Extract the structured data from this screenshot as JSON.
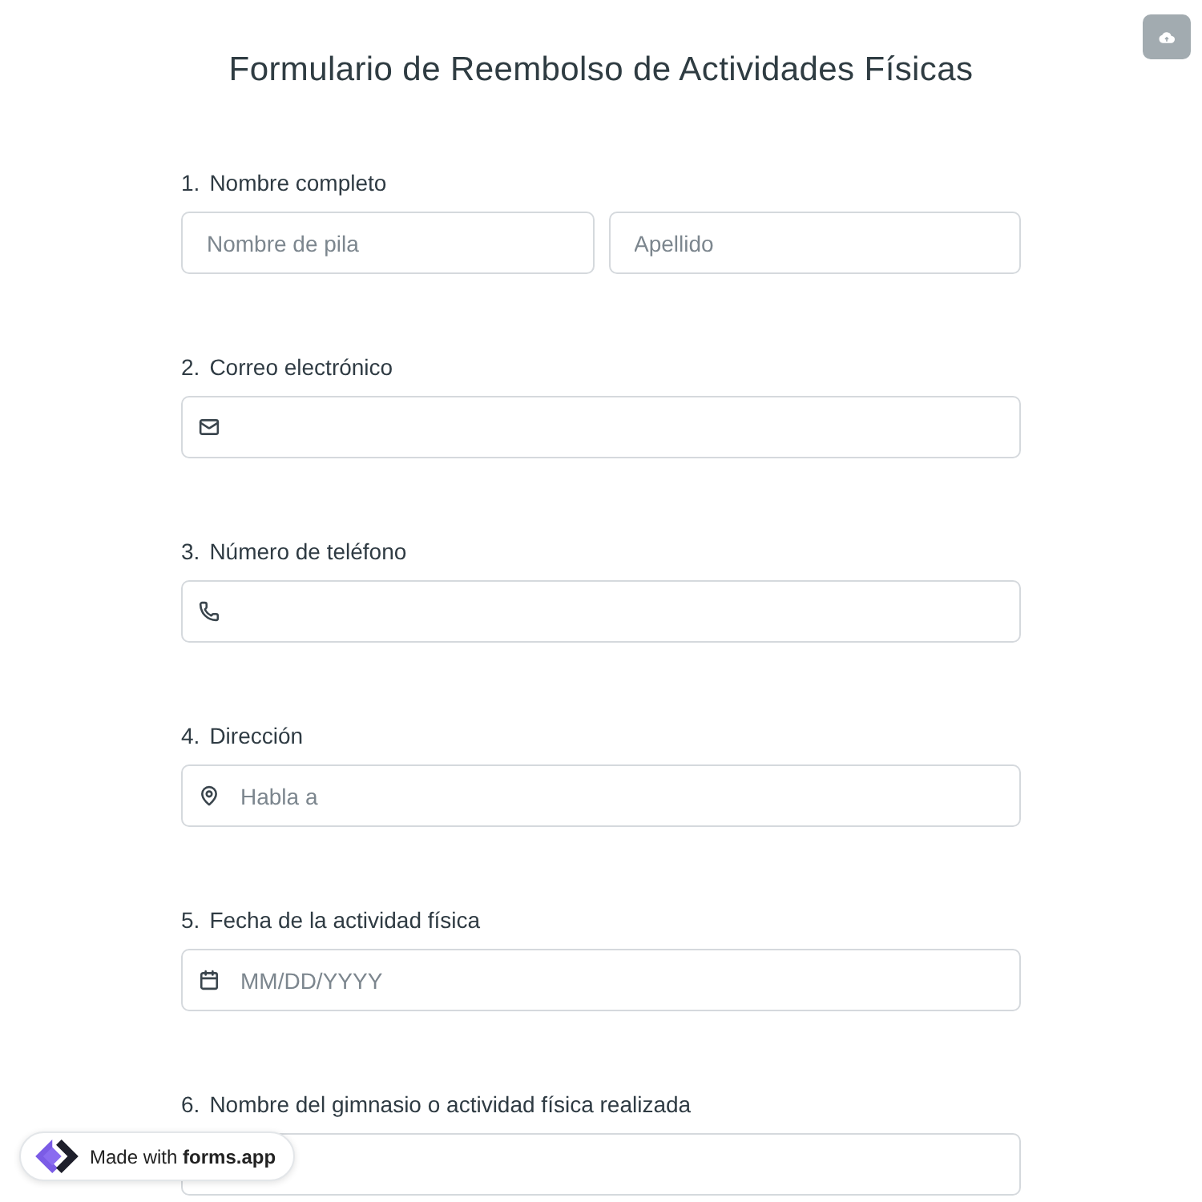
{
  "title": "Formulario de Reembolso de Actividades Físicas",
  "questions": [
    {
      "number": "1.",
      "label": "Nombre completo",
      "fields": [
        {
          "kind": "plain",
          "placeholder": "Nombre de pila"
        },
        {
          "kind": "plain",
          "placeholder": "Apellido"
        }
      ]
    },
    {
      "number": "2.",
      "label": "Correo electrónico",
      "fields": [
        {
          "kind": "mail"
        }
      ]
    },
    {
      "number": "3.",
      "label": "Número de teléfono",
      "fields": [
        {
          "kind": "phone"
        }
      ]
    },
    {
      "number": "4.",
      "label": "Dirección",
      "fields": [
        {
          "kind": "pin",
          "placeholder": "Habla a"
        }
      ]
    },
    {
      "number": "5.",
      "label": "Fecha de la actividad física",
      "fields": [
        {
          "kind": "calendar",
          "placeholder": "MM/DD/YYYY"
        }
      ]
    },
    {
      "number": "6.",
      "label": "Nombre del gimnasio o actividad física realizada",
      "fields": [
        {
          "kind": "plain"
        }
      ]
    }
  ],
  "badge": {
    "text": "Made with **forms.app**"
  }
}
